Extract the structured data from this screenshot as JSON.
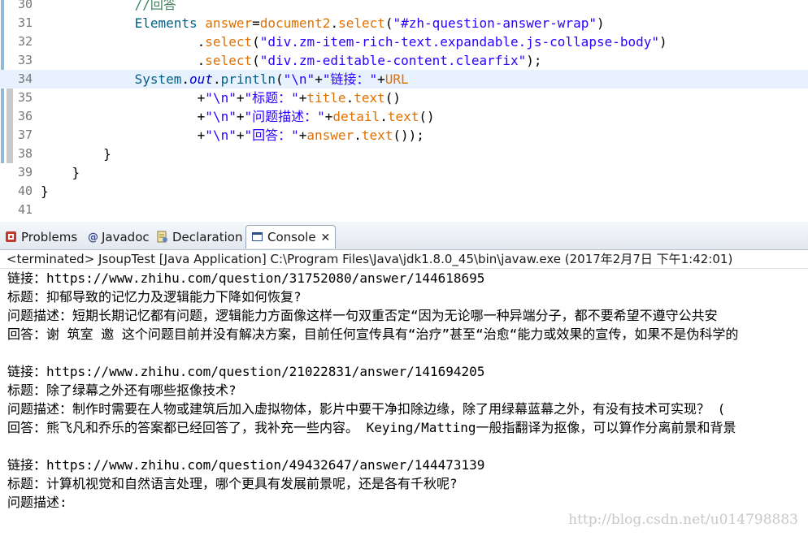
{
  "editor": {
    "lines": [
      {
        "num": "30",
        "segments": [
          {
            "t": "            ",
            "c": ""
          },
          {
            "t": "//回答",
            "c": "cm"
          }
        ]
      },
      {
        "num": "31",
        "segments": [
          {
            "t": "            ",
            "c": ""
          },
          {
            "t": "Elements",
            "c": "kw-type"
          },
          {
            "t": " ",
            "c": ""
          },
          {
            "t": "answer",
            "c": "var"
          },
          {
            "t": "=",
            "c": ""
          },
          {
            "t": "document2",
            "c": "var"
          },
          {
            "t": ".",
            "c": ""
          },
          {
            "t": "select",
            "c": "var"
          },
          {
            "t": "(",
            "c": ""
          },
          {
            "t": "\"#zh-question-answer-wrap\"",
            "c": "str"
          },
          {
            "t": ")",
            "c": ""
          }
        ]
      },
      {
        "num": "32",
        "segments": [
          {
            "t": "                    .",
            "c": ""
          },
          {
            "t": "select",
            "c": "var"
          },
          {
            "t": "(",
            "c": ""
          },
          {
            "t": "\"div.zm-item-rich-text.expandable.js-collapse-body\"",
            "c": "str"
          },
          {
            "t": ")",
            "c": ""
          }
        ]
      },
      {
        "num": "33",
        "segments": [
          {
            "t": "                    .",
            "c": ""
          },
          {
            "t": "select",
            "c": "var"
          },
          {
            "t": "(",
            "c": ""
          },
          {
            "t": "\"div.zm-editable-content.clearfix\"",
            "c": "str"
          },
          {
            "t": ");",
            "c": ""
          }
        ]
      },
      {
        "num": "34",
        "segments": [
          {
            "t": "            ",
            "c": ""
          },
          {
            "t": "System",
            "c": "kw-type"
          },
          {
            "t": ".",
            "c": ""
          },
          {
            "t": "out",
            "c": "fld"
          },
          {
            "t": ".",
            "c": ""
          },
          {
            "t": "println",
            "c": "kw-type"
          },
          {
            "t": "(",
            "c": ""
          },
          {
            "t": "\"\\n\"",
            "c": "str"
          },
          {
            "t": "+",
            "c": ""
          },
          {
            "t": "\"链接：\"",
            "c": "str"
          },
          {
            "t": "+",
            "c": ""
          },
          {
            "t": "URL",
            "c": "var"
          }
        ]
      },
      {
        "num": "35",
        "segments": [
          {
            "t": "                    +",
            "c": ""
          },
          {
            "t": "\"\\n\"",
            "c": "str"
          },
          {
            "t": "+",
            "c": ""
          },
          {
            "t": "\"标题：\"",
            "c": "str"
          },
          {
            "t": "+",
            "c": ""
          },
          {
            "t": "title",
            "c": "var"
          },
          {
            "t": ".",
            "c": ""
          },
          {
            "t": "text",
            "c": "var"
          },
          {
            "t": "()",
            "c": ""
          }
        ]
      },
      {
        "num": "36",
        "segments": [
          {
            "t": "                    +",
            "c": ""
          },
          {
            "t": "\"\\n\"",
            "c": "str"
          },
          {
            "t": "+",
            "c": ""
          },
          {
            "t": "\"问题描述：\"",
            "c": "str"
          },
          {
            "t": "+",
            "c": ""
          },
          {
            "t": "detail",
            "c": "var"
          },
          {
            "t": ".",
            "c": ""
          },
          {
            "t": "text",
            "c": "var"
          },
          {
            "t": "()",
            "c": ""
          }
        ]
      },
      {
        "num": "37",
        "segments": [
          {
            "t": "                    +",
            "c": ""
          },
          {
            "t": "\"\\n\"",
            "c": "str"
          },
          {
            "t": "+",
            "c": ""
          },
          {
            "t": "\"回答：\"",
            "c": "str"
          },
          {
            "t": "+",
            "c": ""
          },
          {
            "t": "answer",
            "c": "var"
          },
          {
            "t": ".",
            "c": ""
          },
          {
            "t": "text",
            "c": "var"
          },
          {
            "t": "());",
            "c": ""
          }
        ]
      },
      {
        "num": "38",
        "segments": [
          {
            "t": "        }",
            "c": ""
          }
        ]
      },
      {
        "num": "39",
        "segments": [
          {
            "t": "    }",
            "c": ""
          }
        ]
      },
      {
        "num": "40",
        "segments": [
          {
            "t": "}",
            "c": ""
          }
        ]
      },
      {
        "num": "41",
        "segments": []
      }
    ]
  },
  "tabs": [
    {
      "label": "Problems",
      "icon": "problems-icon"
    },
    {
      "label": "Javadoc",
      "icon": "javadoc-icon"
    },
    {
      "label": "Declaration",
      "icon": "declaration-icon"
    },
    {
      "label": "Console",
      "icon": "console-icon",
      "active": true
    }
  ],
  "console": {
    "header": "<terminated> JsoupTest [Java Application] C:\\Program Files\\Java\\jdk1.8.0_45\\bin\\javaw.exe (2017年2月7日 下午1:42:01)",
    "lines": [
      "链接：https://www.zhihu.com/question/31752080/answer/144618695",
      "标题：抑郁导致的记忆力及逻辑能力下降如何恢复?",
      "问题描述：短期长期记忆都有问题，逻辑能力方面像这样一句双重否定“因为无论哪一种异端分子，都不要希望不遵守公共安",
      "回答：谢 筑室 邀 这个问题目前并没有解决方案，目前任何宣传具有“治疗”甚至“治愈“能力或效果的宣传，如果不是伪科学的",
      "",
      "链接：https://www.zhihu.com/question/21022831/answer/141694205",
      "标题：除了绿幕之外还有哪些抠像技术?",
      "问题描述：制作时需要在人物或建筑后加入虚拟物体，影片中要干净扣除边缘，除了用绿幕蓝幕之外，有没有技术可实现？ (",
      "回答：熊飞凡和乔乐的答案都已经回答了，我补充一些内容。 Keying/Matting一般指翻译为抠像，可以算作分离前景和背景",
      "",
      "链接：https://www.zhihu.com/question/49432647/answer/144473139",
      "标题：计算机视觉和自然语言处理，哪个更具有发展前景呢，还是各有千秋呢?",
      "问题描述:"
    ]
  },
  "watermark": "http://blog.csdn.net/u014798883"
}
